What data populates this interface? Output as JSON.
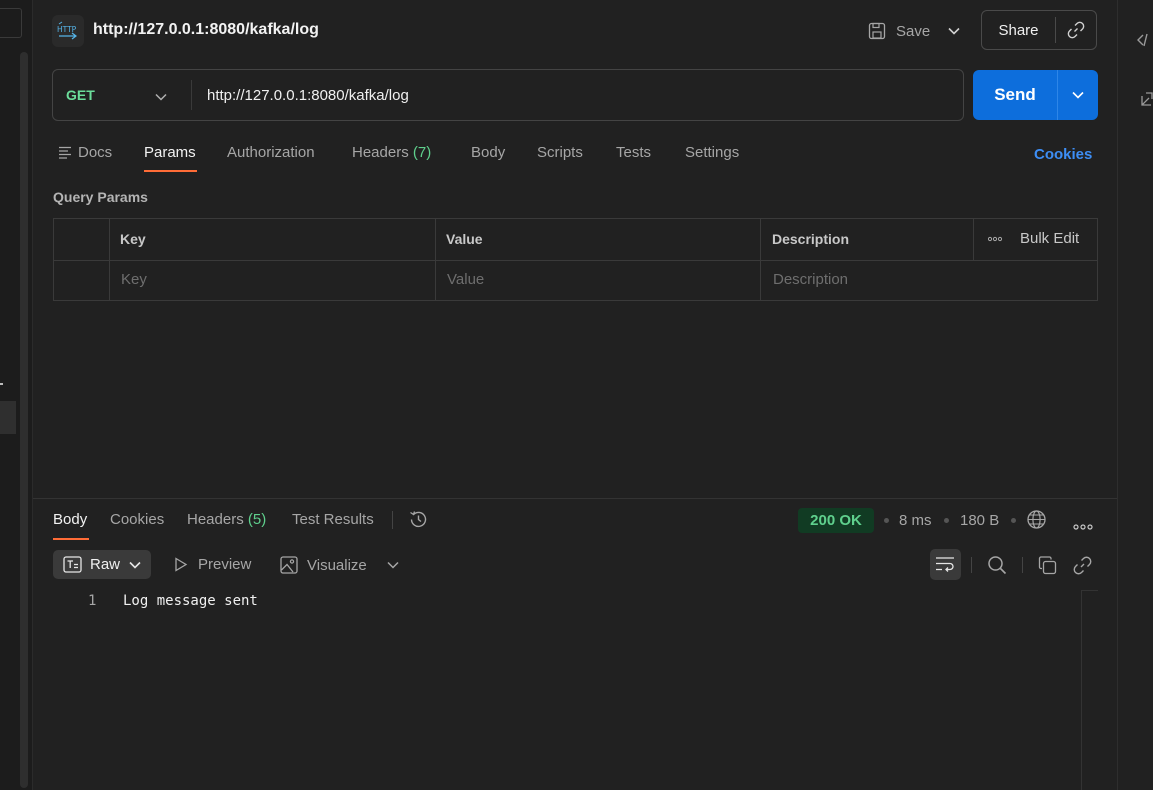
{
  "request": {
    "title": "http://127.0.0.1:8080/kafka/log",
    "method": "GET",
    "url": "http://127.0.0.1:8080/kafka/log",
    "save_label": "Save",
    "share_label": "Share",
    "send_label": "Send",
    "http_icon_text": "HTTP"
  },
  "request_tabs": {
    "docs": "Docs",
    "params": "Params",
    "authorization": "Authorization",
    "headers": "Headers",
    "headers_count": "(7)",
    "body": "Body",
    "scripts": "Scripts",
    "tests": "Tests",
    "settings": "Settings",
    "cookies": "Cookies",
    "active": "Params"
  },
  "query_params": {
    "title": "Query Params",
    "columns": [
      "Key",
      "Value",
      "Description"
    ],
    "bulk_edit": "Bulk Edit",
    "placeholders": {
      "key": "Key",
      "value": "Value",
      "description": "Description"
    }
  },
  "response": {
    "tabs": {
      "body": "Body",
      "cookies": "Cookies",
      "headers": "Headers",
      "headers_count": "(5)",
      "test_results": "Test Results",
      "active": "Body"
    },
    "status": "200 OK",
    "time": "8 ms",
    "size": "180 B",
    "format": "Raw",
    "preview": "Preview",
    "visualize": "Visualize",
    "lines": [
      {
        "num": "1",
        "text": "Log message sent"
      }
    ]
  },
  "colors": {
    "accent_orange": "#ff6c37",
    "send_blue": "#0d6edc",
    "method_green": "#6bdd9a",
    "status_green": "#5fd08d",
    "link_blue": "#3d8ef5"
  },
  "icons": [
    "http-icon",
    "save-icon",
    "chevron-down-icon",
    "link-icon",
    "code-icon",
    "expand-icon",
    "docs-icon",
    "more-icon",
    "history-icon",
    "globe-icon",
    "raw-icon",
    "play-icon",
    "image-icon",
    "wrap-icon",
    "search-icon",
    "copy-icon"
  ]
}
